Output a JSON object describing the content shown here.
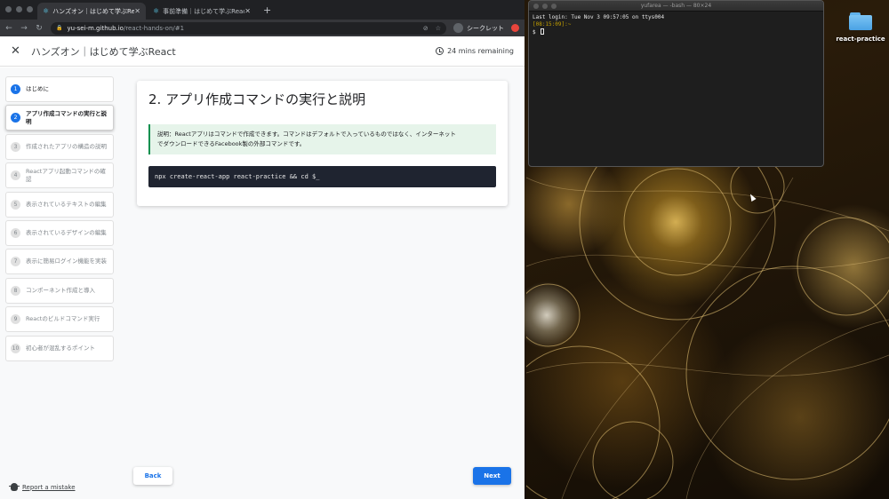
{
  "browser": {
    "tabs": [
      {
        "label": "ハンズオン｜はじめて学ぶReact",
        "active": true
      },
      {
        "label": "事前準備｜はじめて学ぶReact",
        "active": false
      }
    ],
    "new_tab": "+",
    "url_host": "yu-sei-m.github.io",
    "url_path": "/react-hands-on/#1",
    "incognito_label": "シークレット"
  },
  "header": {
    "title": "ハンズオン｜はじめて学ぶReact",
    "remaining": "24 mins remaining"
  },
  "steps": [
    {
      "num": "1",
      "label": "はじめに",
      "state": "done"
    },
    {
      "num": "2",
      "label": "アプリ作成コマンドの実行と説明",
      "state": "current"
    },
    {
      "num": "3",
      "label": "作成されたアプリの構造の説明",
      "state": "todo"
    },
    {
      "num": "4",
      "label": "Reactアプリ起動コマンドの確認",
      "state": "todo"
    },
    {
      "num": "5",
      "label": "表示されているテキストの編集",
      "state": "todo"
    },
    {
      "num": "6",
      "label": "表示されているデザインの編集",
      "state": "todo"
    },
    {
      "num": "7",
      "label": "表示に簡易ログイン機能を実装",
      "state": "todo"
    },
    {
      "num": "8",
      "label": "コンポーネント作成と導入",
      "state": "todo"
    },
    {
      "num": "9",
      "label": "Reactのビルドコマンド実行",
      "state": "todo"
    },
    {
      "num": "10",
      "label": "初心者が混乱するポイント",
      "state": "todo"
    }
  ],
  "main": {
    "title": "2. アプリ作成コマンドの実行と説明",
    "callout_line1": "説明：Reactアプリはコマンドで作成できます。コマンドはデフォルトで入っているものではなく、インターネット",
    "callout_line2": "でダウンロードできるFacebook製の外部コマンドです。",
    "code": "npx create-react-app react-practice && cd $_"
  },
  "footer": {
    "back": "Back",
    "next": "Next",
    "report": "Report a mistake"
  },
  "terminal": {
    "title": "yufarea — -bash — 80×24",
    "line1": "Last login: Tue Nov  3 09:57:05 on ttys004",
    "line2": "[08:15:09]:~",
    "line3": "$ "
  },
  "desktop": {
    "folder_label": "react-practice"
  },
  "colors": {
    "accent": "#1a73e8",
    "callout_bg": "#e6f4ea",
    "callout_border": "#0d904f",
    "code_bg": "#1f2430"
  }
}
